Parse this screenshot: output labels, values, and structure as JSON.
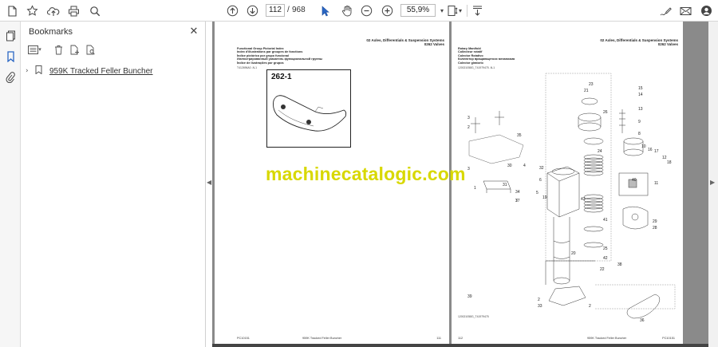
{
  "toolbar": {
    "page_current": "112",
    "page_separator": "/",
    "page_total": "968",
    "zoom": "55,9%"
  },
  "bookmarks": {
    "title": "Bookmarks",
    "items": [
      {
        "label": "959K Tracked Feller Buncher"
      }
    ]
  },
  "page_left": {
    "header_right_line1": "02 Axles, Differentials & Suspension Systems",
    "header_right_line2": "0262 Valves",
    "header_left_lines": [
      "Functional Group Pictorial Index",
      "Index d'illustrations par groupes de fonctions",
      "Índice pictórico por grupo funcional",
      "Иллюстрированный указатель функциональной группы",
      "Índice de ilustrações por grupos"
    ],
    "fig_ref": "T412696A0 -N-1",
    "fig_label": "262-1",
    "footer_left": "PC10151",
    "footer_center": "959K Tracked Feller Buncher",
    "footer_right": "111"
  },
  "page_right": {
    "header_right_line1": "02 Axles, Differentials & Suspension Systems",
    "header_right_line2": "0262 Valves",
    "header_left_lines": [
      "Rotary Manifold",
      "Collecteur rotatif",
      "Colector Rotativo",
      "Коллектор вращающегося механизма",
      "Colector giratorio"
    ],
    "fig_ref": "120021058G_T41979475 -N-1",
    "footer_left": "112",
    "footer_center": "959K Tracked Feller Buncher",
    "footer_right": "PC10151",
    "sub_fig_ref": "120021058G_T41979475",
    "callouts": [
      "23",
      "21",
      "26",
      "15",
      "14",
      "13",
      "9",
      "8",
      "3",
      "2",
      "1",
      "24",
      "35",
      "3",
      "10",
      "16",
      "17",
      "12",
      "18",
      "11",
      "30",
      "4",
      "31",
      "32",
      "7",
      "6",
      "19",
      "5",
      "34",
      "37",
      "40",
      "43",
      "20",
      "41",
      "29",
      "28",
      "25",
      "42",
      "22",
      "33",
      "38",
      "2",
      "36",
      "39",
      "2"
    ]
  },
  "watermark": "machinecatalogic.com"
}
